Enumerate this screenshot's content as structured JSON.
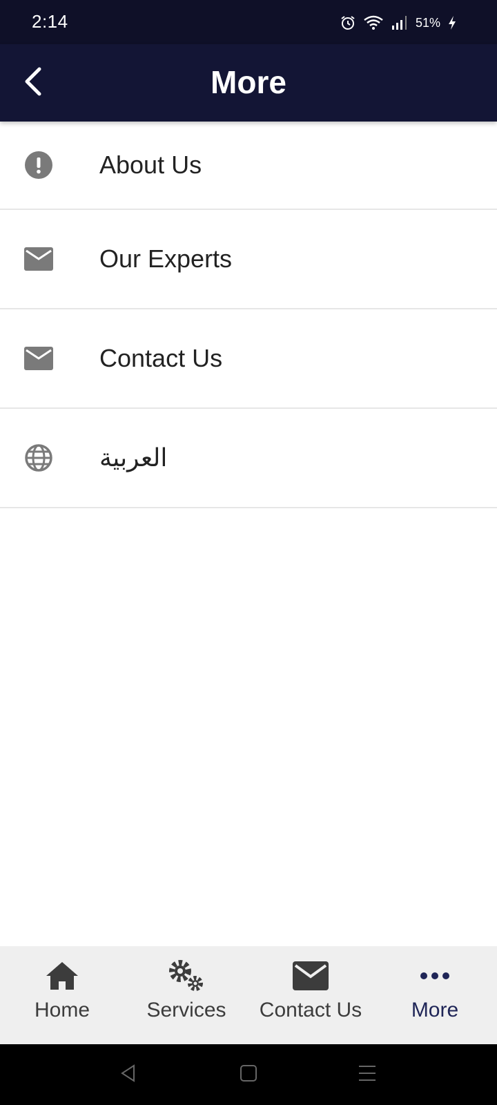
{
  "status_bar": {
    "time": "2:14",
    "battery": "51%",
    "icons": [
      "alarm-icon",
      "wifi-icon",
      "signal-icon",
      "battery-charging-icon"
    ]
  },
  "app_bar": {
    "title": "More",
    "back_icon": "back-arrow-icon",
    "background": "#131535"
  },
  "menu": {
    "items": [
      {
        "label": "About Us",
        "icon": "info-icon"
      },
      {
        "label": "Our Experts",
        "icon": "mail-icon"
      },
      {
        "label": "Contact Us",
        "icon": "mail-icon"
      },
      {
        "label": "العربية",
        "icon": "globe-icon"
      }
    ]
  },
  "bottom_nav": {
    "items": [
      {
        "label": "Home",
        "icon": "home-icon"
      },
      {
        "label": "Services",
        "icon": "gears-icon"
      },
      {
        "label": "Contact Us",
        "icon": "mail-icon"
      },
      {
        "label": "More",
        "icon": "more-dots-icon",
        "active": true
      }
    ],
    "active_color": "#1f2557",
    "inactive_color": "#3c3c3c"
  },
  "system_nav": {
    "icons": [
      "back-triangle-icon",
      "home-square-icon",
      "recents-menu-icon"
    ]
  }
}
